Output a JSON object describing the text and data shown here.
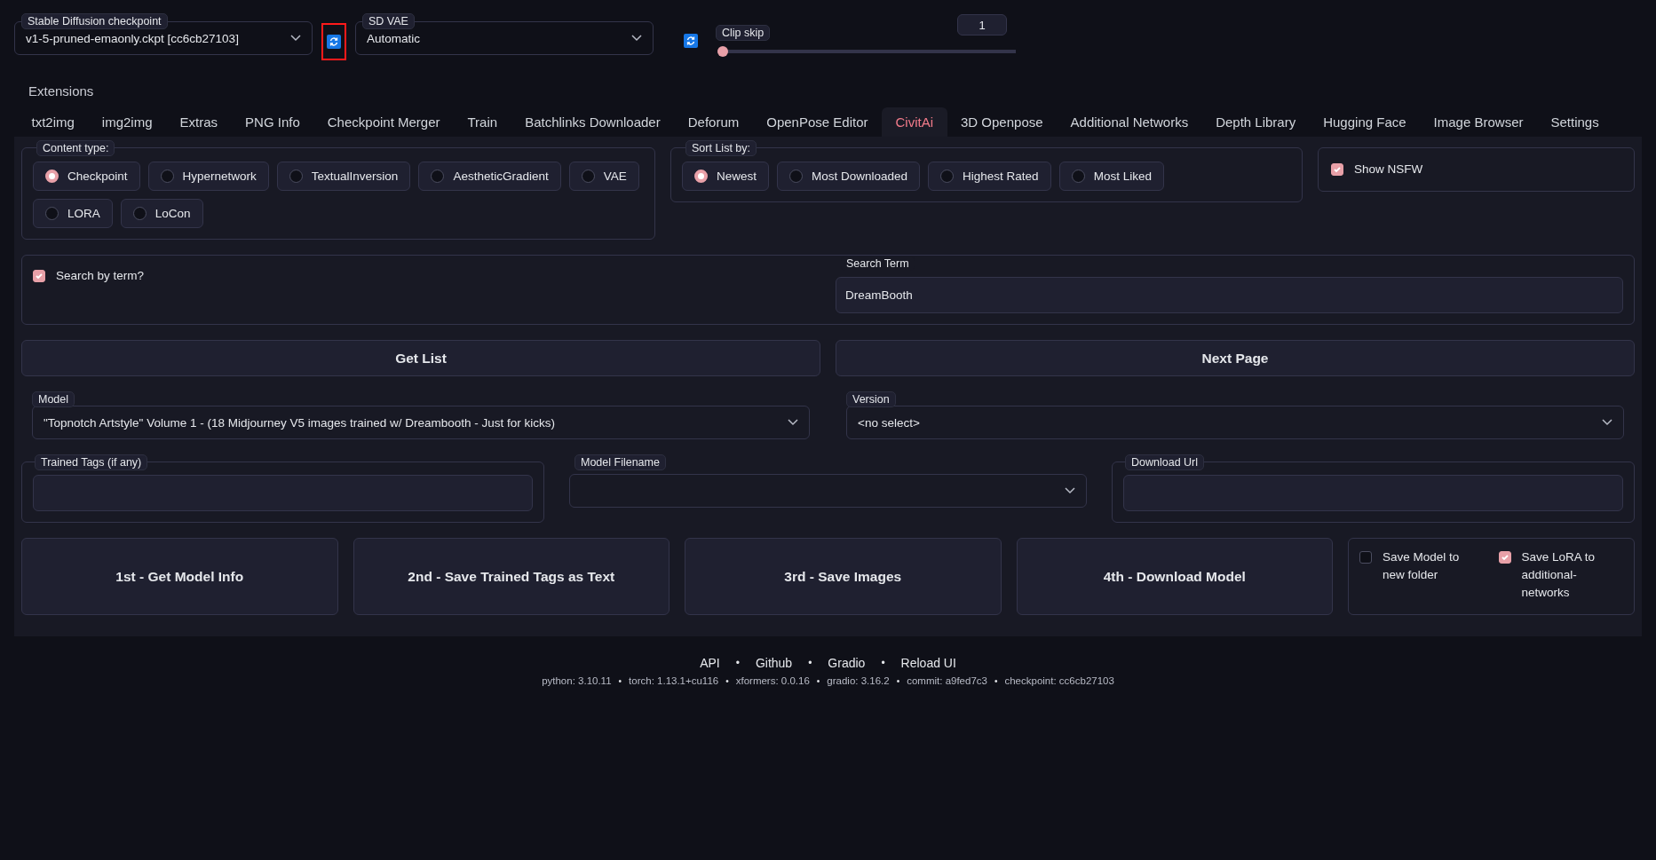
{
  "top": {
    "checkpoint": {
      "label": "Stable Diffusion checkpoint",
      "value": "v1-5-pruned-emaonly.ckpt [cc6cb27103]"
    },
    "refresh_buttons": [
      {
        "highlighted": true
      },
      {
        "highlighted": false
      }
    ],
    "vae": {
      "label": "SD VAE",
      "value": "Automatic"
    },
    "clip_skip": {
      "label": "Clip skip",
      "value": "1",
      "level": 0
    }
  },
  "extensions_label": "Extensions",
  "tabs": [
    {
      "label": "txt2img",
      "selected": false
    },
    {
      "label": "img2img",
      "selected": false
    },
    {
      "label": "Extras",
      "selected": false
    },
    {
      "label": "PNG Info",
      "selected": false
    },
    {
      "label": "Checkpoint Merger",
      "selected": false
    },
    {
      "label": "Train",
      "selected": false
    },
    {
      "label": "Batchlinks Downloader",
      "selected": false
    },
    {
      "label": "Deforum",
      "selected": false
    },
    {
      "label": "OpenPose Editor",
      "selected": false
    },
    {
      "label": "CivitAi",
      "selected": true
    },
    {
      "label": "3D Openpose",
      "selected": false
    },
    {
      "label": "Additional Networks",
      "selected": false
    },
    {
      "label": "Depth Library",
      "selected": false
    },
    {
      "label": "Hugging Face",
      "selected": false
    },
    {
      "label": "Image Browser",
      "selected": false
    },
    {
      "label": "Settings",
      "selected": false
    }
  ],
  "content_type": {
    "label": "Content type:",
    "options": [
      {
        "label": "Checkpoint",
        "selected": true
      },
      {
        "label": "Hypernetwork",
        "selected": false
      },
      {
        "label": "TextualInversion",
        "selected": false
      },
      {
        "label": "AestheticGradient",
        "selected": false
      },
      {
        "label": "VAE",
        "selected": false
      },
      {
        "label": "LORA",
        "selected": false
      },
      {
        "label": "LoCon",
        "selected": false
      }
    ]
  },
  "sort_list": {
    "label": "Sort List by:",
    "options": [
      {
        "label": "Newest",
        "selected": true
      },
      {
        "label": "Most Downloaded",
        "selected": false
      },
      {
        "label": "Highest Rated",
        "selected": false
      },
      {
        "label": "Most Liked",
        "selected": false
      }
    ]
  },
  "show_nsfw": {
    "label": "Show NSFW",
    "checked": true
  },
  "search": {
    "checkbox": {
      "label": "Search by term?",
      "checked": true
    },
    "label": "Search Term",
    "value": "DreamBooth"
  },
  "list_buttons": [
    "Get List",
    "Next Page"
  ],
  "model": {
    "label": "Model",
    "value": "\"Topnotch Artstyle\" Volume 1 - (18 Midjourney V5 images trained w/ Dreambooth - Just for kicks)"
  },
  "version": {
    "label": "Version",
    "value": "<no select>"
  },
  "trained_tags": {
    "label": "Trained Tags (if any)"
  },
  "model_filename": {
    "label": "Model Filename"
  },
  "download_url": {
    "label": "Download Url"
  },
  "actions": [
    "1st - Get Model Info",
    "2nd - Save Trained Tags as Text",
    "3rd - Save Images",
    "4th - Download Model"
  ],
  "save_options": [
    {
      "label": "Save Model to new folder",
      "checked": false
    },
    {
      "label": "Save LoRA to additional-networks",
      "checked": true
    }
  ],
  "footer": {
    "separator": "•",
    "links": [
      "API",
      "Github",
      "Gradio",
      "Reload UI"
    ],
    "versions": [
      "python: 3.10.11",
      "torch: 1.13.1+cu116",
      "xformers: 0.0.16",
      "gradio: 3.16.2",
      "commit: a9fed7c3",
      "checkpoint: cc6cb27103"
    ]
  }
}
